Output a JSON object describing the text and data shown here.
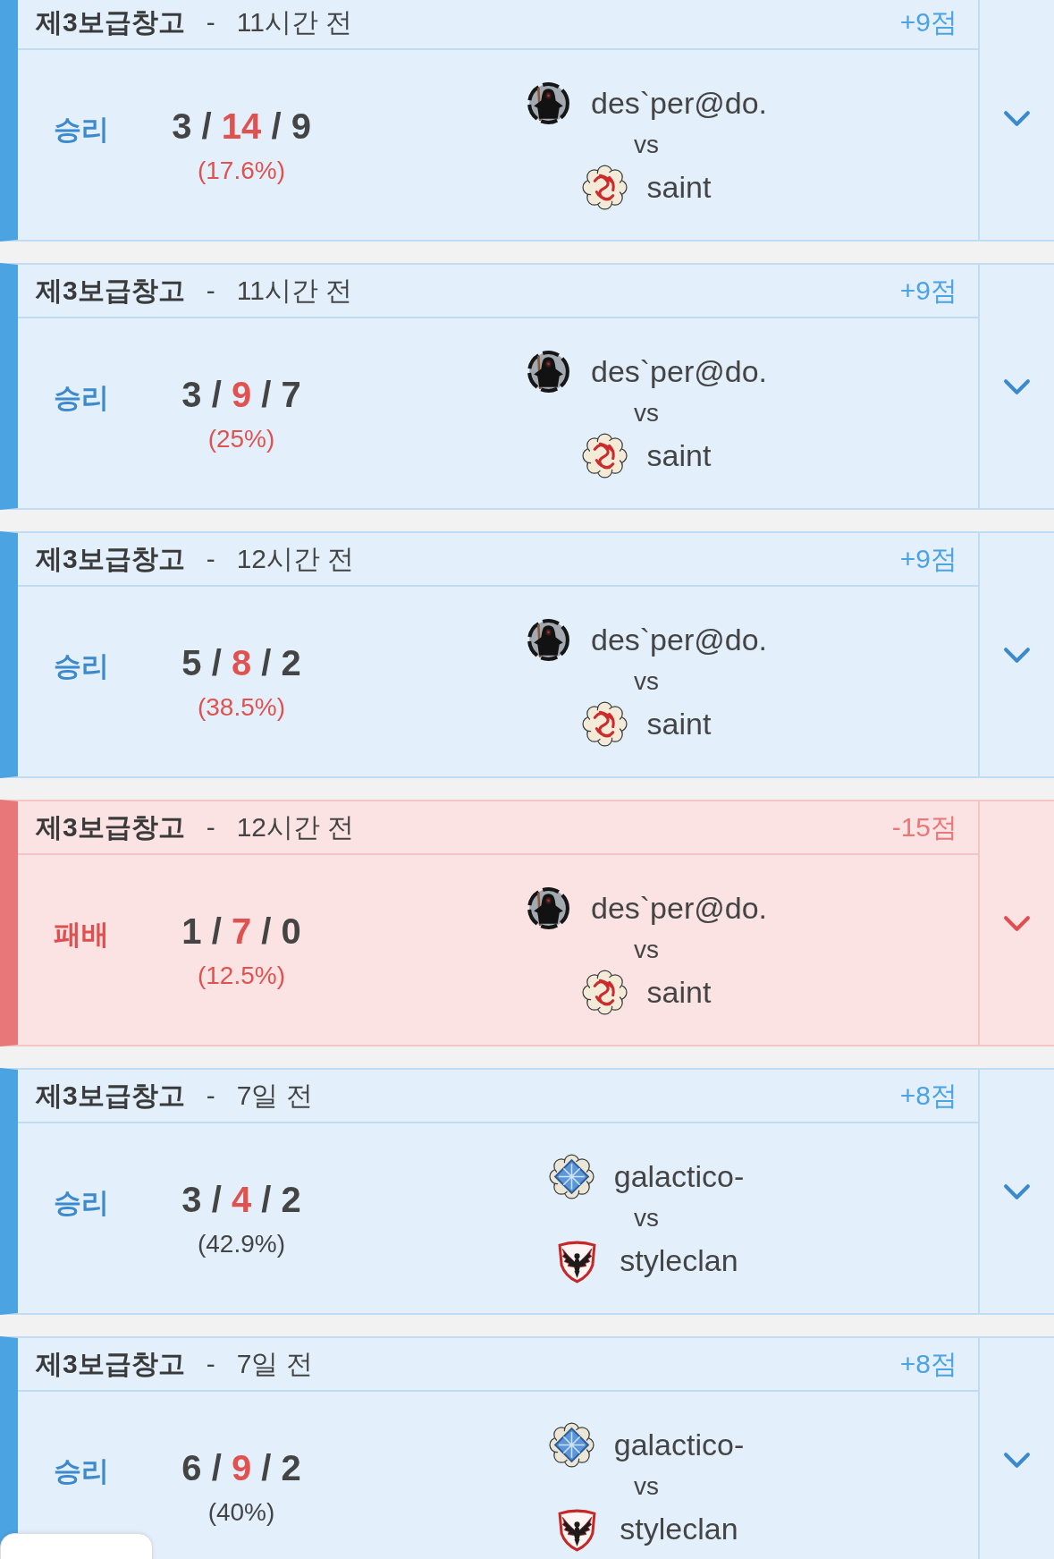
{
  "matches": [
    {
      "kind": "win",
      "map": "제3보급창고",
      "separator": "-",
      "time": "11시간 전",
      "points": "+9점",
      "result": "승리",
      "kda": {
        "kills": "3",
        "deaths": "14",
        "assists": "9",
        "separators": [
          "/",
          "/"
        ]
      },
      "ratio": "(17.6%)",
      "ratio_alert": true,
      "teams": [
        {
          "name": "des`per@do.",
          "kind": "reaper"
        },
        {
          "name": "saint",
          "kind": "dragon"
        }
      ],
      "vs": "vs",
      "expanded": false
    },
    {
      "kind": "win",
      "map": "제3보급창고",
      "separator": "-",
      "time": "11시간 전",
      "points": "+9점",
      "result": "승리",
      "kda": {
        "kills": "3",
        "deaths": "9",
        "assists": "7",
        "separators": [
          "/",
          "/"
        ]
      },
      "ratio": "(25%)",
      "ratio_alert": true,
      "teams": [
        {
          "name": "des`per@do.",
          "kind": "reaper"
        },
        {
          "name": "saint",
          "kind": "dragon"
        }
      ],
      "vs": "vs",
      "expanded": false
    },
    {
      "kind": "win",
      "map": "제3보급창고",
      "separator": "-",
      "time": "12시간 전",
      "points": "+9점",
      "result": "승리",
      "kda": {
        "kills": "5",
        "deaths": "8",
        "assists": "2",
        "separators": [
          "/",
          "/"
        ]
      },
      "ratio": "(38.5%)",
      "ratio_alert": true,
      "teams": [
        {
          "name": "des`per@do.",
          "kind": "reaper"
        },
        {
          "name": "saint",
          "kind": "dragon"
        }
      ],
      "vs": "vs",
      "expanded": false
    },
    {
      "kind": "loss",
      "map": "제3보급창고",
      "separator": "-",
      "time": "12시간 전",
      "points": "-15점",
      "result": "패배",
      "kda": {
        "kills": "1",
        "deaths": "7",
        "assists": "0",
        "separators": [
          "/",
          "/"
        ]
      },
      "ratio": "(12.5%)",
      "ratio_alert": true,
      "teams": [
        {
          "name": "des`per@do.",
          "kind": "reaper"
        },
        {
          "name": "saint",
          "kind": "dragon"
        }
      ],
      "vs": "vs",
      "expanded": false
    },
    {
      "kind": "win",
      "map": "제3보급창고",
      "separator": "-",
      "time": "7일 전",
      "points": "+8점",
      "result": "승리",
      "kda": {
        "kills": "3",
        "deaths": "4",
        "assists": "2",
        "separators": [
          "/",
          "/"
        ]
      },
      "ratio": "(42.9%)",
      "ratio_alert": false,
      "teams": [
        {
          "name": "galactico-",
          "kind": "diamond"
        },
        {
          "name": "styleclan",
          "kind": "phoenix"
        }
      ],
      "vs": "vs",
      "expanded": false
    },
    {
      "kind": "win",
      "map": "제3보급창고",
      "separator": "-",
      "time": "7일 전",
      "points": "+8점",
      "result": "승리",
      "kda": {
        "kills": "6",
        "deaths": "9",
        "assists": "2",
        "separators": [
          "/",
          "/"
        ]
      },
      "ratio": "(40%)",
      "ratio_alert": false,
      "teams": [
        {
          "name": "galactico-",
          "kind": "diamond"
        },
        {
          "name": "styleclan",
          "kind": "phoenix"
        }
      ],
      "vs": "vs",
      "expanded": false
    }
  ]
}
